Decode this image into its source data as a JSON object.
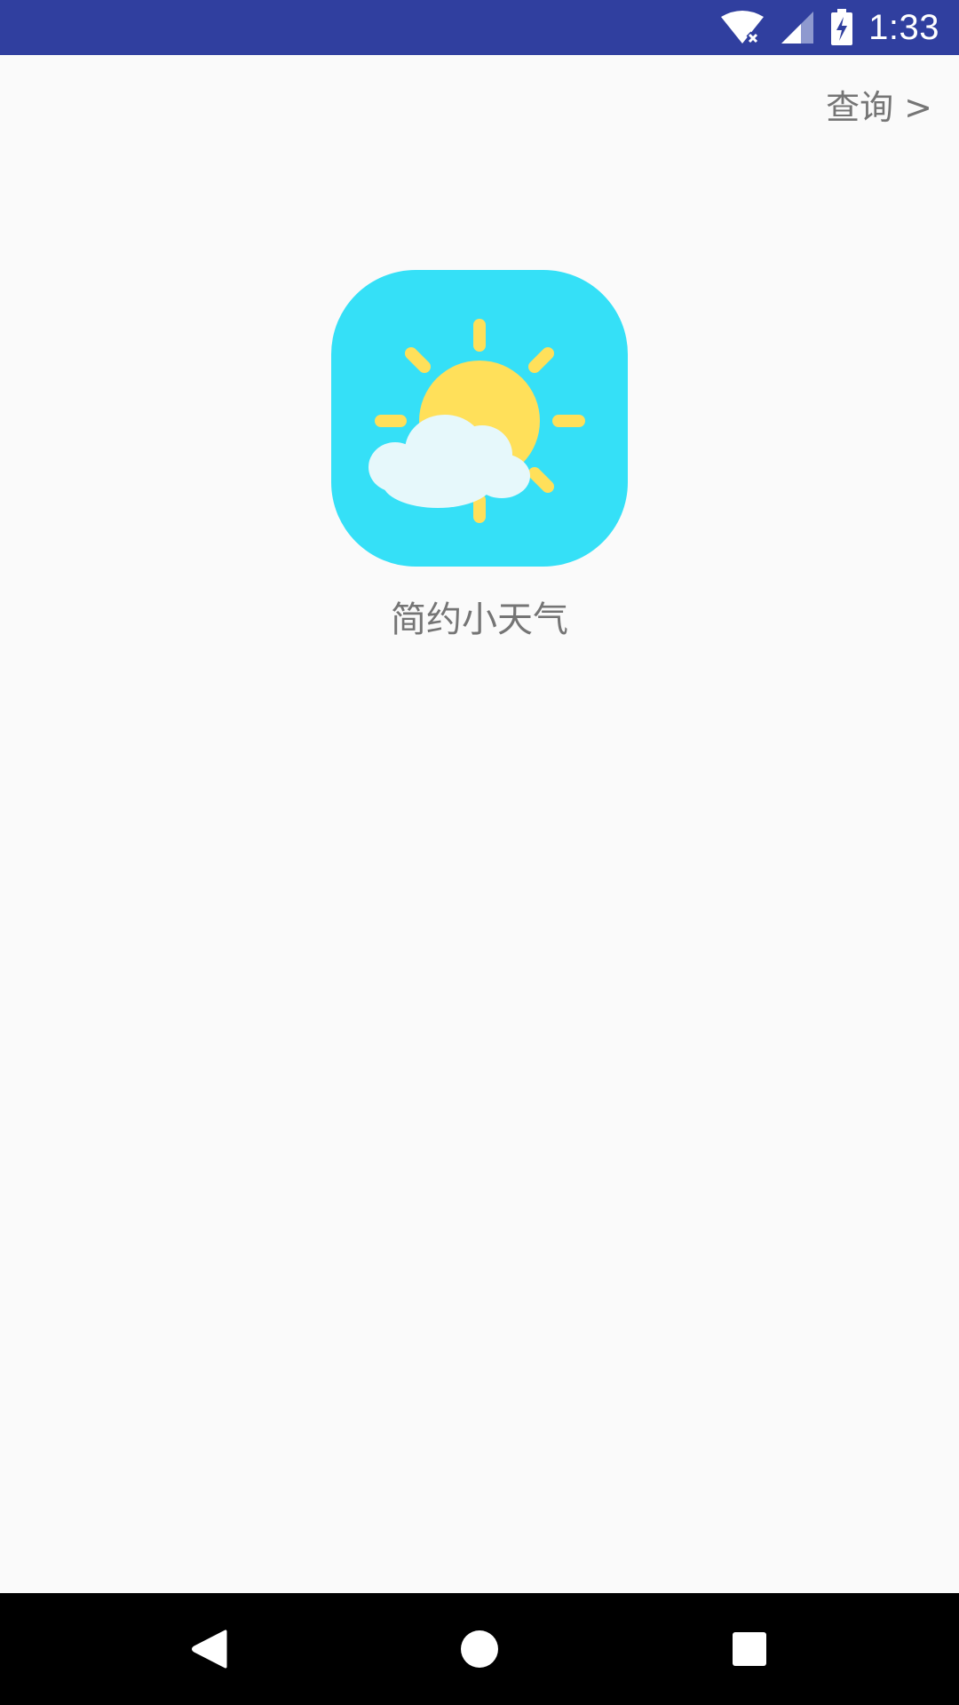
{
  "status_bar": {
    "time": "1:33",
    "icons": [
      "wifi-no-internet-icon",
      "cell-signal-icon",
      "battery-charging-icon"
    ],
    "background_color": "#303f9f"
  },
  "header": {
    "query_label": "查询 >"
  },
  "app": {
    "name": "简约小天气",
    "logo_icon": "sun-behind-cloud-icon",
    "logo_bg_color": "#35e0f7",
    "sun_color": "#ffe05a",
    "cloud_color": "#e6f8fb"
  },
  "nav_bar": {
    "buttons": [
      "back-icon",
      "home-icon",
      "recents-icon"
    ]
  }
}
